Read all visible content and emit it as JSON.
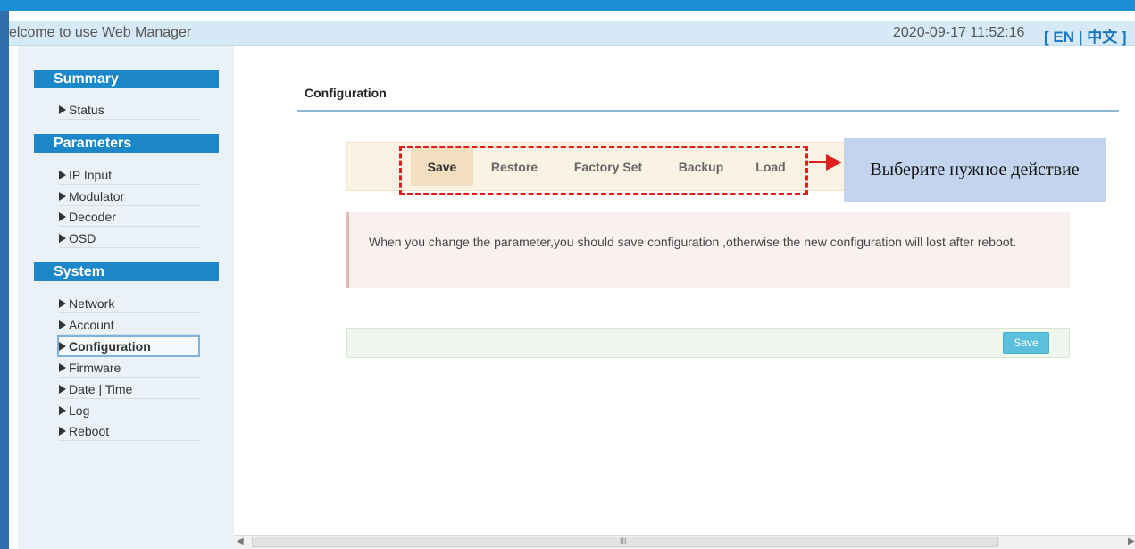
{
  "header": {
    "welcome": "elcome to use Web Manager",
    "datetime": "2020-09-17 11:52:16",
    "lang": "[ EN | 中文 ]"
  },
  "sidebar": {
    "sections": [
      {
        "title": "Summary",
        "items": [
          "Status"
        ]
      },
      {
        "title": "Parameters",
        "items": [
          "IP Input",
          "Modulator",
          "Decoder",
          "OSD"
        ]
      },
      {
        "title": "System",
        "items": [
          "Network",
          "Account",
          "Configuration",
          "Firmware",
          "Date | Time",
          "Log",
          "Reboot"
        ]
      }
    ],
    "active_item": "Configuration"
  },
  "main": {
    "title": "Configuration",
    "tabs": [
      "Save",
      "Restore",
      "Factory Set",
      "Backup",
      "Load"
    ],
    "active_tab": "Save",
    "callout": "Выберите нужное действие",
    "notice": "When you change the parameter,you should save configuration ,otherwise the new configuration will lost after reboot.",
    "save_button": "Save"
  },
  "colors": {
    "accent": "#1c87c9",
    "annotation": "#e01e1e",
    "callout_bg": "#c3d5ee",
    "save_button": "#5bc0de"
  },
  "scrollbar": {
    "grip": "III"
  }
}
